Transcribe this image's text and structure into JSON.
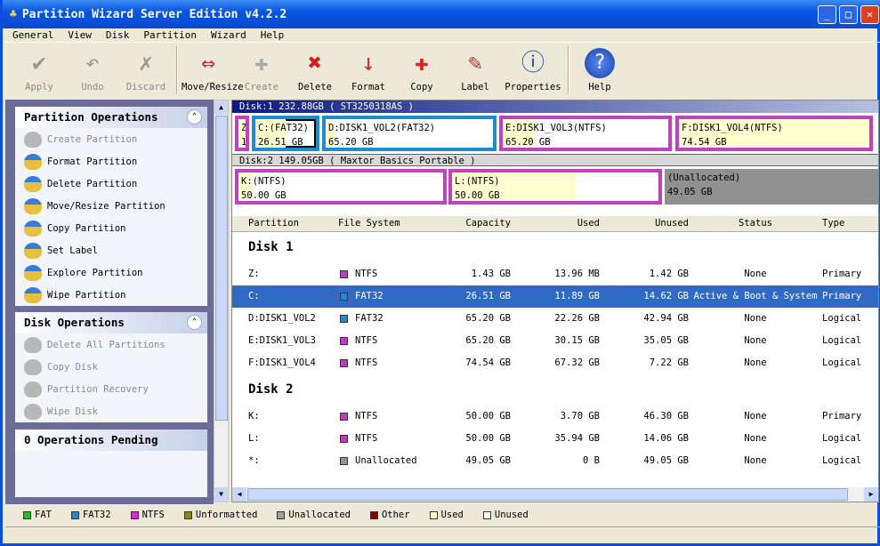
{
  "window": {
    "title": "Partition Wizard Server Edition v4.2.2"
  },
  "menu": [
    "General",
    "View",
    "Disk",
    "Partition",
    "Wizard",
    "Help"
  ],
  "toolbar": [
    {
      "label": "Apply",
      "icon": "check-icon",
      "enabled": false
    },
    {
      "label": "Undo",
      "icon": "undo-icon",
      "enabled": false
    },
    {
      "label": "Discard",
      "icon": "discard-icon",
      "enabled": false
    },
    {
      "label": "Move/Resize",
      "icon": "move-resize-icon",
      "enabled": true
    },
    {
      "label": "Create",
      "icon": "create-icon",
      "enabled": false
    },
    {
      "label": "Delete",
      "icon": "delete-icon",
      "enabled": true
    },
    {
      "label": "Format",
      "icon": "format-icon",
      "enabled": true
    },
    {
      "label": "Copy",
      "icon": "copy-icon",
      "enabled": true
    },
    {
      "label": "Label",
      "icon": "label-icon",
      "enabled": true
    },
    {
      "label": "Properties",
      "icon": "properties-icon",
      "enabled": true
    },
    {
      "label": "Help",
      "icon": "help-icon",
      "enabled": true
    }
  ],
  "partition_ops": {
    "title": "Partition Operations",
    "items": [
      {
        "label": "Create Partition",
        "enabled": false
      },
      {
        "label": "Format Partition",
        "enabled": true
      },
      {
        "label": "Delete Partition",
        "enabled": true
      },
      {
        "label": "Move/Resize Partition",
        "enabled": true
      },
      {
        "label": "Copy Partition",
        "enabled": true
      },
      {
        "label": "Set Label",
        "enabled": true
      },
      {
        "label": "Explore Partition",
        "enabled": true
      },
      {
        "label": "Wipe Partition",
        "enabled": true
      }
    ]
  },
  "disk_ops": {
    "title": "Disk Operations",
    "items": [
      {
        "label": "Delete All Partitions",
        "enabled": false
      },
      {
        "label": "Copy Disk",
        "enabled": false
      },
      {
        "label": "Partition Recovery",
        "enabled": false
      },
      {
        "label": "Wipe Disk",
        "enabled": false
      }
    ]
  },
  "pending": {
    "title": "0 Operations Pending"
  },
  "disk1": {
    "header": "Disk:1 232.88GB  ( ST3250318AS )",
    "parts": [
      {
        "l1": "Z",
        "l2": "1",
        "color": "#c040c0"
      },
      {
        "l1": "C:(FAT32)",
        "l2": "26.51 GB",
        "color": "#1e8ad0"
      },
      {
        "l1": "D:DISK1_VOL2(FAT32)",
        "l2": "65.20 GB",
        "color": "#1e8ad0"
      },
      {
        "l1": "E:DISK1_VOL3(NTFS)",
        "l2": "65.20 GB",
        "color": "#c040c0"
      },
      {
        "l1": "F:DISK1_VOL4(NTFS)",
        "l2": "74.54 GB",
        "color": "#c040c0"
      }
    ]
  },
  "disk2": {
    "header": "Disk:2 149.05GB  ( Maxtor Basics Portable )",
    "parts": [
      {
        "l1": "K:(NTFS)",
        "l2": "50.00 GB",
        "color": "#c040c0"
      },
      {
        "l1": "L:(NTFS)",
        "l2": "50.00 GB",
        "color": "#c040c0"
      },
      {
        "l1": "(Unallocated)",
        "l2": "49.05 GB",
        "color": "#909090"
      }
    ]
  },
  "table": {
    "columns": [
      "Partition",
      "File System",
      "Capacity",
      "Used",
      "Unused",
      "Status",
      "Type"
    ],
    "groups": [
      {
        "title": "Disk 1",
        "rows": [
          [
            "Z:",
            "NTFS",
            "1.43 GB",
            "13.96 MB",
            "1.42 GB",
            "None",
            "Primary"
          ],
          [
            "C:",
            "FAT32",
            "26.51 GB",
            "11.89 GB",
            "14.62 GB",
            "Active & Boot & System",
            "Primary"
          ],
          [
            "D:DISK1_VOL2",
            "FAT32",
            "65.20 GB",
            "22.26 GB",
            "42.94 GB",
            "None",
            "Logical"
          ],
          [
            "E:DISK1_VOL3",
            "NTFS",
            "65.20 GB",
            "30.15 GB",
            "35.05 GB",
            "None",
            "Logical"
          ],
          [
            "F:DISK1_VOL4",
            "NTFS",
            "74.54 GB",
            "67.32 GB",
            "7.22 GB",
            "None",
            "Logical"
          ]
        ]
      },
      {
        "title": "Disk 2",
        "rows": [
          [
            "K:",
            "NTFS",
            "50.00 GB",
            "3.70 GB",
            "46.30 GB",
            "None",
            "Primary"
          ],
          [
            "L:",
            "NTFS",
            "50.00 GB",
            "35.94 GB",
            "14.06 GB",
            "None",
            "Logical"
          ],
          [
            "*:",
            "Unallocated",
            "49.05 GB",
            "0 B",
            "49.05 GB",
            "None",
            "Logical"
          ]
        ]
      }
    ],
    "selected_row": "C:"
  },
  "fs_colors": {
    "NTFS": "#d030d0",
    "FAT32": "#1e8ad0",
    "Unallocated": "#909090"
  },
  "legend": [
    {
      "label": "FAT",
      "color": "#20c020"
    },
    {
      "label": "FAT32",
      "color": "#1e8ad0"
    },
    {
      "label": "NTFS",
      "color": "#d030d0"
    },
    {
      "label": "Unformatted",
      "color": "#888820"
    },
    {
      "label": "Unallocated",
      "color": "#a0a0a0"
    },
    {
      "label": "Other",
      "color": "#900000"
    },
    {
      "label": "Used",
      "color": "#ffffd0"
    },
    {
      "label": "Unused",
      "color": "#ffffff"
    }
  ]
}
